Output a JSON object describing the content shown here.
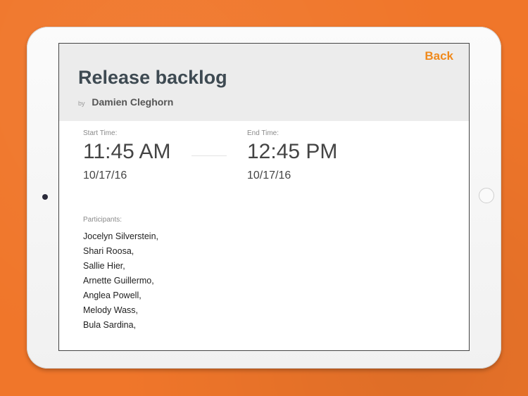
{
  "header": {
    "back_label": "Back",
    "title": "Release backlog",
    "by_label": "by",
    "author": "Damien Cleghorn"
  },
  "start": {
    "label": "Start Time:",
    "time": "11:45 AM",
    "date": "10/17/16"
  },
  "end": {
    "label": "End Time:",
    "time": "12:45 PM",
    "date": "10/17/16"
  },
  "participants": {
    "label": "Participants:",
    "names": [
      "Jocelyn Silverstein,",
      "Shari Roosa,",
      "Sallie Hier,",
      "Arnette Guillermo,",
      "Anglea Powell,",
      "Melody Wass,",
      "Bula Sardina,"
    ]
  },
  "colors": {
    "background": "#f0762a",
    "accent": "#f08a1c",
    "header_bg": "#ececec",
    "title": "#3e4a52"
  }
}
